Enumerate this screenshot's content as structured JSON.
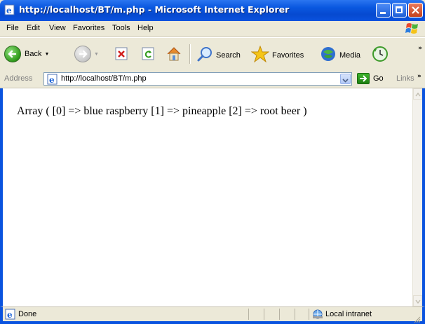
{
  "window": {
    "title": "http://localhost/BT/m.php - Microsoft Internet Explorer"
  },
  "menu": {
    "file": "File",
    "edit": "Edit",
    "view": "View",
    "favorites": "Favorites",
    "tools": "Tools",
    "help": "Help"
  },
  "toolbar": {
    "back_label": "Back",
    "search_label": "Search",
    "favorites_label": "Favorites",
    "media_label": "Media",
    "icons": [
      "back-icon",
      "forward-icon",
      "stop-icon",
      "refresh-icon",
      "home-icon",
      "search-icon",
      "favorites-star-icon",
      "media-icon",
      "history-icon"
    ]
  },
  "address": {
    "label": "Address",
    "url": "http://localhost/BT/m.php",
    "go_label": "Go",
    "links_label": "Links"
  },
  "content": {
    "text": "Array ( [0] => blue raspberry [1] => pineapple [2] => root beer )"
  },
  "status": {
    "text": "Done",
    "zone": "Local intranet"
  },
  "colors": {
    "titlebar": "#0a53df",
    "chrome": "#ece9d8",
    "page_background": "#ffffff"
  }
}
